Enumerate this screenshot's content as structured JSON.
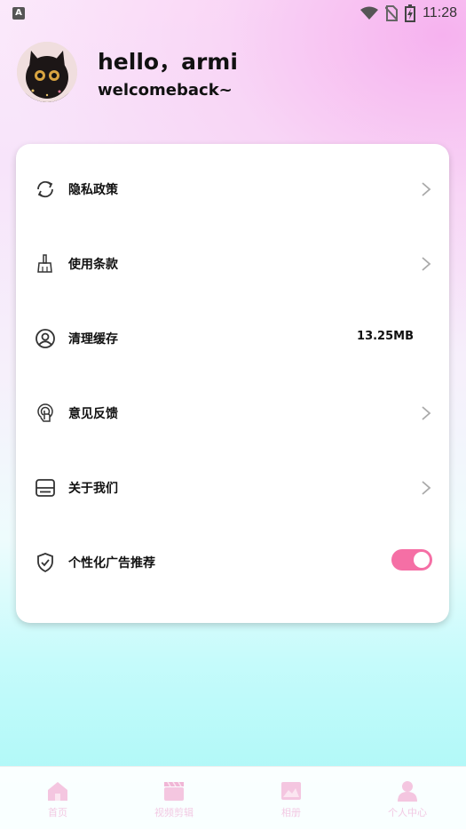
{
  "status_bar": {
    "app_icon_letter": "A",
    "time": "11:28"
  },
  "header": {
    "greeting": "hello，armi",
    "subtitle": "welcomeback~"
  },
  "settings": {
    "items": [
      {
        "label": "隐私政策",
        "icon": "refresh-icon"
      },
      {
        "label": "使用条款",
        "icon": "broom-icon"
      },
      {
        "label": "清理缓存",
        "icon": "user-circle-icon",
        "value": "13.25MB"
      },
      {
        "label": "意见反馈",
        "icon": "touch-icon"
      },
      {
        "label": "关于我们",
        "icon": "stack-icon"
      },
      {
        "label": "个性化广告推荐",
        "icon": "shield-check-icon",
        "toggle_on": true
      }
    ]
  },
  "bottom_nav": {
    "items": [
      {
        "label": "首页",
        "icon": "home-icon"
      },
      {
        "label": "视频剪辑",
        "icon": "clapperboard-icon"
      },
      {
        "label": "相册",
        "icon": "image-icon"
      },
      {
        "label": "个人中心",
        "icon": "person-icon"
      }
    ]
  },
  "colors": {
    "accent": "#f56fa5",
    "nav_label": "#f2c9e3"
  }
}
